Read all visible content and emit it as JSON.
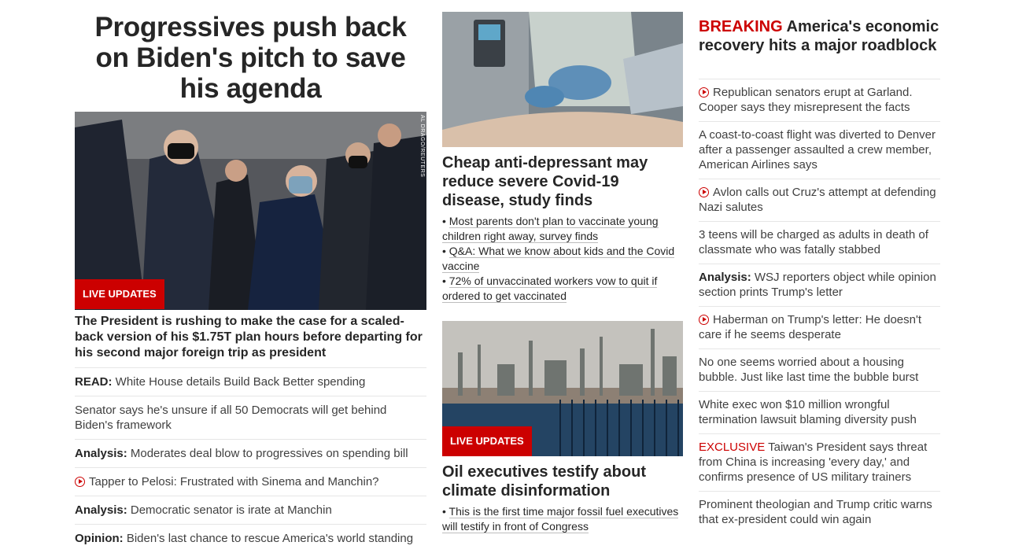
{
  "lead": {
    "headline": "Progressives push back on Biden's pitch to save his agenda",
    "badge": "LIVE UPDATES",
    "credit": "AL DRAGO/REUTERS",
    "summary": "The President is rushing to make the case for a scaled-back version of his $1.75T plan hours before departing for his second major foreign trip as president",
    "links": [
      {
        "prefix": "READ:",
        "text": "White House details Build Back Better spending",
        "video": false
      },
      {
        "prefix": "",
        "text": "Senator says he's unsure if all 50 Democrats will get behind Biden's framework",
        "video": false
      },
      {
        "prefix": "Analysis:",
        "text": "Moderates deal blow to progressives on spending bill",
        "video": false
      },
      {
        "prefix": "",
        "text": "Tapper to Pelosi: Frustrated with Sinema and Manchin?",
        "video": true
      },
      {
        "prefix": "Analysis:",
        "text": "Democratic senator is irate at Manchin",
        "video": false
      },
      {
        "prefix": "Opinion:",
        "text": "Biden's last chance to rescue America's world standing",
        "video": false
      }
    ]
  },
  "story2": {
    "headline": "Cheap anti-depressant may reduce severe Covid-19 disease, study finds",
    "bullets": [
      "Most parents don't plan to vaccinate young children right away, survey finds",
      "Q&A: What we know about kids and the Covid vaccine",
      "72% of unvaccinated workers vow to quit if ordered to get vaccinated"
    ]
  },
  "story3": {
    "badge": "LIVE UPDATES",
    "headline": "Oil executives testify about climate disinformation",
    "bullets": [
      "This is the first time major fossil fuel executives will testify in front of Congress"
    ]
  },
  "col3": {
    "breaking_label": "BREAKING",
    "breaking_headline": "America's economic recovery hits a major roadblock",
    "links": [
      {
        "prefix": "",
        "label": "",
        "text": "Republican senators erupt at Garland. Cooper says they misrepresent the facts",
        "video": true
      },
      {
        "prefix": "",
        "label": "",
        "text": "A coast-to-coast flight was diverted to Denver after a passenger assaulted a crew member, American Airlines says",
        "video": false
      },
      {
        "prefix": "",
        "label": "",
        "text": "Avlon calls out Cruz's attempt at defending Nazi salutes",
        "video": true
      },
      {
        "prefix": "",
        "label": "",
        "text": "3 teens will be charged as adults in death of classmate who was fatally stabbed",
        "video": false
      },
      {
        "prefix": "Analysis:",
        "label": "",
        "text": "WSJ reporters object while opinion section prints Trump's letter",
        "video": false
      },
      {
        "prefix": "",
        "label": "",
        "text": "Haberman on Trump's letter: He doesn't care if he seems desperate",
        "video": true
      },
      {
        "prefix": "",
        "label": "",
        "text": "No one seems worried about a housing bubble. Just like last time the bubble burst",
        "video": false
      },
      {
        "prefix": "",
        "label": "",
        "text": "White exec won $10 million wrongful termination lawsuit blaming diversity push",
        "video": false
      },
      {
        "prefix": "",
        "label": "EXCLUSIVE",
        "text": "Taiwan's President says threat from China is increasing 'every day,' and confirms presence of US military trainers",
        "video": false
      },
      {
        "prefix": "",
        "label": "",
        "text": "Prominent theologian and Trump critic warns that ex-president could win again",
        "video": false
      }
    ]
  },
  "colors": {
    "accent": "#cc0000",
    "text": "#262626",
    "divider": "#e6e6e6"
  }
}
